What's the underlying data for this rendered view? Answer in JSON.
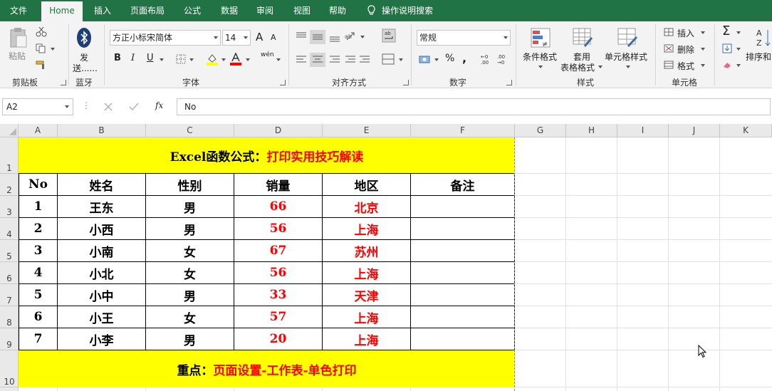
{
  "tabs": [
    "文件",
    "Home",
    "插入",
    "页面布局",
    "公式",
    "数据",
    "审阅",
    "视图",
    "帮助"
  ],
  "tell_me": "操作说明搜索",
  "ribbon": {
    "clipboard": {
      "paste": "粘贴",
      "label": "剪贴板"
    },
    "bluetooth": {
      "send": "发",
      "send2": "送......",
      "label": "蓝牙"
    },
    "font": {
      "name": "方正小标宋简体",
      "size": "14",
      "bold": "B",
      "italic": "I",
      "underline": "U",
      "grow": "A",
      "shrink": "A",
      "phonetic": "wén",
      "label": "字体"
    },
    "alignment": {
      "label": "对齐方式"
    },
    "number": {
      "format": "常规",
      "percent": "%",
      "comma": ",",
      "label": "数字"
    },
    "styles": {
      "conditional": "条件格式",
      "table1": "套用",
      "table2": "表格格式",
      "cell_styles": "单元格样式",
      "label": "样式"
    },
    "cells": {
      "insert": "插入",
      "delete": "删除",
      "format": "格式",
      "label": "单元格"
    },
    "editing": {
      "sort": "排序和"
    }
  },
  "formula_bar": {
    "name_box": "A2",
    "fx": "fx",
    "content": "No"
  },
  "columns": [
    "A",
    "B",
    "C",
    "D",
    "E",
    "F",
    "G",
    "H",
    "I",
    "J",
    "K"
  ],
  "rows": [
    "1",
    "2",
    "3",
    "4",
    "5",
    "6",
    "7",
    "8",
    "9",
    "10"
  ],
  "sheet": {
    "title_black": "Excel函数公式：",
    "title_red": "打印实用技巧解读",
    "headers": [
      "No",
      "姓名",
      "性别",
      "销量",
      "地区",
      "备注"
    ],
    "records": [
      [
        "1",
        "王东",
        "男",
        "66",
        "北京",
        ""
      ],
      [
        "2",
        "小西",
        "男",
        "56",
        "上海",
        ""
      ],
      [
        "3",
        "小南",
        "女",
        "67",
        "苏州",
        ""
      ],
      [
        "4",
        "小北",
        "女",
        "56",
        "上海",
        ""
      ],
      [
        "5",
        "小中",
        "男",
        "33",
        "天津",
        ""
      ],
      [
        "6",
        "小王",
        "女",
        "57",
        "上海",
        ""
      ],
      [
        "7",
        "小李",
        "男",
        "20",
        "上海",
        ""
      ]
    ],
    "footer_black": "重点：",
    "footer_red": "页面设置-工作表-单色打印"
  },
  "colors": {
    "ribbon_green": "#217346",
    "highlight": "#ffff00",
    "emphasis": "#ff0000"
  }
}
